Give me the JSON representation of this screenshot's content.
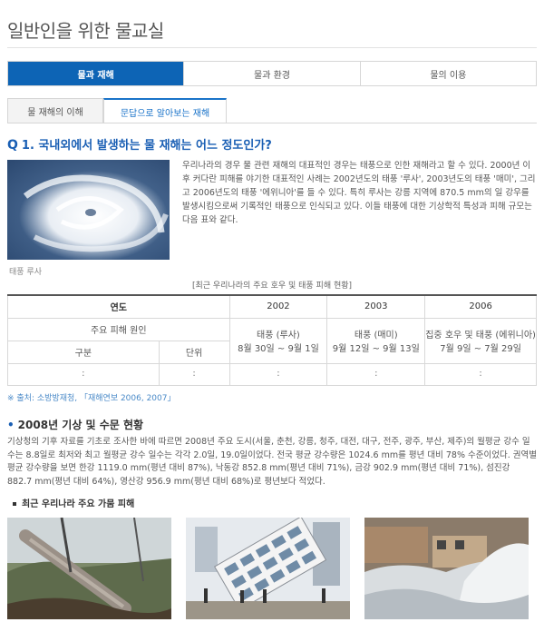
{
  "header": {
    "title": "일반인을 위한 물교실"
  },
  "main_tabs": [
    {
      "label": "물과 재해",
      "active": true
    },
    {
      "label": "물과 환경",
      "active": false
    },
    {
      "label": "물의 이용",
      "active": false
    }
  ],
  "sub_tabs": [
    {
      "label": "물 재해의 이해",
      "active": false
    },
    {
      "label": "문답으로 알아보는 재해",
      "active": true
    }
  ],
  "question": {
    "marker": "Q",
    "text": "1. 국내외에서 발생하는 물 재해는 어느 정도인가?"
  },
  "intro": {
    "image_caption": "태풍 루사",
    "text": "우리나라의 경우 물 관련 재해의 대표적인 경우는 태풍으로 인한 재해라고 할 수 있다. 2000년 이후 커다란 피해를 야기한 대표적인 사례는 2002년도의 태풍 '루사', 2003년도의 태풍 '매미', 그리고 2006년도의 태풍 '에위니아'를 들 수 있다. 특히 루사는 강릉 지역에 870.5 mm의 일 강우를 발생시킴으로써 기록적인 태풍으로 인식되고 있다. 이들 태풍에 대한 기상학적 특성과 피해 규모는 다음 표와 같다."
  },
  "table": {
    "caption": "[최근 우리나라의 주요 호우 및 태풍 피해 현황]",
    "col_year": "연도",
    "years": [
      "2002",
      "2003",
      "2006"
    ],
    "row_cause": "주요 피해 원인",
    "row_category": "구분",
    "row_unit": "단위",
    "causes": [
      {
        "name": "태풍 (루사)",
        "period": "8월 30일 ~ 9월 1일"
      },
      {
        "name": "태풍 (매미)",
        "period": "9월 12일 ~ 9월 13일"
      },
      {
        "name": "집중 호우 및 태풍 (에위니아)",
        "period": "7월 9일 ~ 7월 29일"
      }
    ],
    "ellipsis": ":"
  },
  "source": "※ 출처: 소방방재청, 「재해연보 2006, 2007」",
  "section": {
    "title": "2008년 기상 및 수문 현황",
    "body": "기상청의 기후 자료를 기초로 조사한 바에 따르면 2008년 주요 도시(서울, 춘천, 강릉, 청주, 대전, 대구, 전주, 광주, 부산, 제주)의 월평균 강수 일수는 8.8일로 최저와 최고 월평균 강수 일수는 각각 2.0일, 19.0일이었다. 전국 평균 강수량은 1024.6 mm를 평년 대비 78% 수준이었다. 권역별 평균 강수량을 보면 한강 1119.0 mm(평년 대비 87%), 낙동강 852.8 mm(평년 대비 71%), 금강 902.9 mm(평년 대비 71%), 섬진강 882.7 mm(평년 대비 64%), 영산강 956.9 mm(평년 대비 68%)로 평년보다 적었다."
  },
  "subsection": {
    "title": "최근 우리나라 주요 가뭄 피해"
  },
  "photos": [
    "fallen-pole-photo",
    "collapsed-building-photo",
    "storm-surge-photo"
  ]
}
